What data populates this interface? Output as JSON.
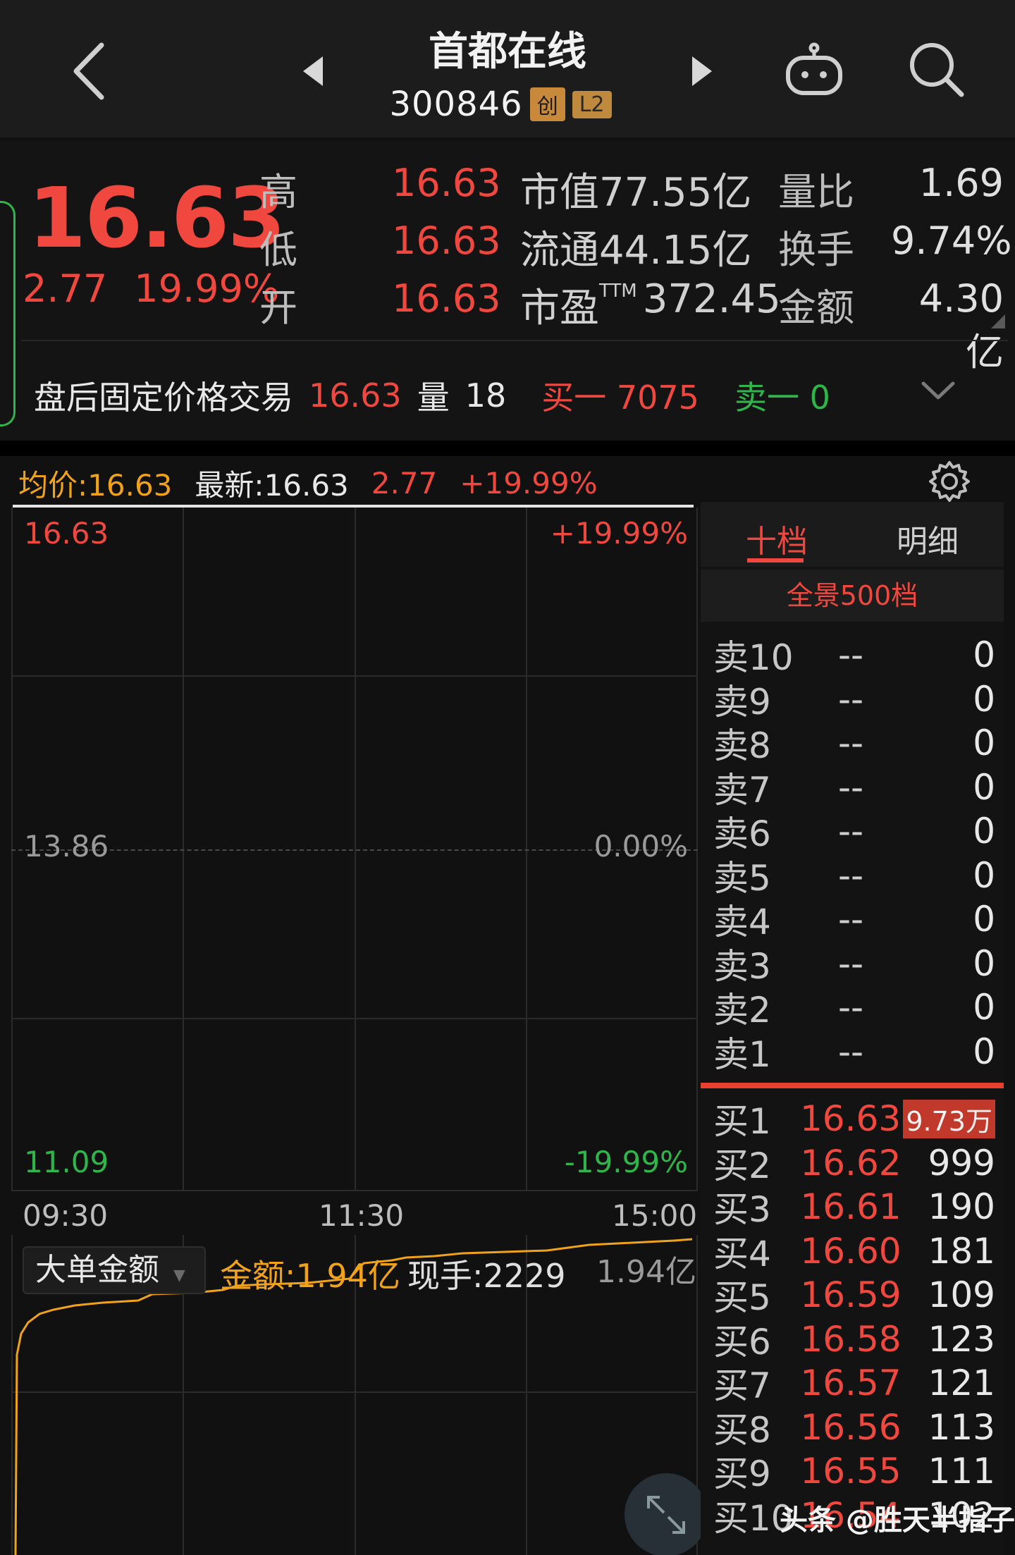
{
  "header": {
    "title": "首都在线",
    "code": "300846",
    "tag_chuang": "创",
    "tag_l2": "L2"
  },
  "quote": {
    "price": "16.63",
    "change": "2.77",
    "change_pct": "19.99%",
    "high_label": "高",
    "high": "16.63",
    "low_label": "低",
    "low": "16.63",
    "open_label": "开",
    "open": "16.63",
    "mktcap": "市值77.55亿",
    "float": "流通44.15亿",
    "pe_label": "市盈",
    "pe_sup": "TTM",
    "pe_value": "372.45",
    "vol_ratio_label": "量比",
    "vol_ratio": "1.69",
    "turnover_label": "换手",
    "turnover": "9.74%",
    "amount_label": "金额",
    "amount": "4.30亿"
  },
  "post_trading": {
    "label": "盘后固定价格交易",
    "price": "16.63",
    "vol_label": "量",
    "vol": "18",
    "buy1": "买一 7075",
    "sell1": "卖一 0"
  },
  "chart_header": {
    "avg": "均价:16.63",
    "latest": "最新:16.63",
    "change": "2.77",
    "pct": "+19.99%"
  },
  "chart_axes": {
    "top_left": "16.63",
    "top_right": "+19.99%",
    "mid_left": "13.86",
    "mid_right": "0.00%",
    "bot_left": "11.09",
    "bot_right": "-19.99%",
    "time_start": "09:30",
    "time_mid": "11:30",
    "time_end": "15:00"
  },
  "lower_chart": {
    "select": "大单金额",
    "amount": "金额:1.94亿",
    "hand": "现手:2229",
    "right_label": "1.94亿"
  },
  "book": {
    "tab_ten": "十档",
    "tab_detail": "明细",
    "panorama": "全景500档",
    "sells": [
      {
        "label": "卖10",
        "price": "--",
        "vol": "0"
      },
      {
        "label": "卖9",
        "price": "--",
        "vol": "0"
      },
      {
        "label": "卖8",
        "price": "--",
        "vol": "0"
      },
      {
        "label": "卖7",
        "price": "--",
        "vol": "0"
      },
      {
        "label": "卖6",
        "price": "--",
        "vol": "0"
      },
      {
        "label": "卖5",
        "price": "--",
        "vol": "0"
      },
      {
        "label": "卖4",
        "price": "--",
        "vol": "0"
      },
      {
        "label": "卖3",
        "price": "--",
        "vol": "0"
      },
      {
        "label": "卖2",
        "price": "--",
        "vol": "0"
      },
      {
        "label": "卖1",
        "price": "--",
        "vol": "0"
      }
    ],
    "buys": [
      {
        "label": "买1",
        "price": "16.63",
        "vol": "9.73万"
      },
      {
        "label": "买2",
        "price": "16.62",
        "vol": "999"
      },
      {
        "label": "买3",
        "price": "16.61",
        "vol": "190"
      },
      {
        "label": "买4",
        "price": "16.60",
        "vol": "181"
      },
      {
        "label": "买5",
        "price": "16.59",
        "vol": "109"
      },
      {
        "label": "买6",
        "price": "16.58",
        "vol": "123"
      },
      {
        "label": "买7",
        "price": "16.57",
        "vol": "121"
      },
      {
        "label": "买8",
        "price": "16.56",
        "vol": "113"
      },
      {
        "label": "买9",
        "price": "16.55",
        "vol": "111"
      },
      {
        "label": "买10",
        "price": "16.54",
        "vol": "102"
      }
    ]
  },
  "watermark": "头条 @胜天半指子",
  "colors": {
    "up": "#f0483e",
    "down": "#2fb54a",
    "avg": "#f0a21a"
  }
}
